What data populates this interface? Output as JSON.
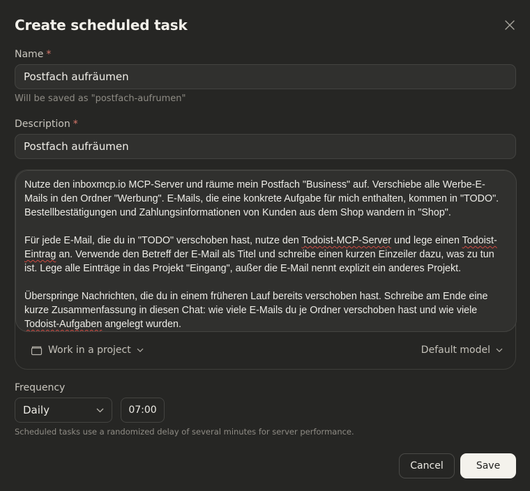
{
  "dialog": {
    "title": "Create scheduled task",
    "close_icon": "close-icon"
  },
  "name_field": {
    "label": "Name",
    "required_mark": "*",
    "value": "Postfach aufräumen",
    "hint": "Will be saved as \"postfach-aufrumen\""
  },
  "description_field": {
    "label": "Description",
    "required_mark": "*",
    "value": "Postfach aufräumen"
  },
  "prompt": {
    "p1": "Nutze den inboxmcp.io MCP-Server und räume mein Postfach \"Business\" auf. Verschiebe alle Werbe-E-Mails in den Ordner \"Werbung\". E-Mails, die eine konkrete Aufgabe für mich enthalten, kommen in \"TODO\". Bestellbestätigungen und Zahlungsinformationen von Kunden aus dem Shop wandern in \"Shop\".",
    "p2_a": "Für jede E-Mail, die du in \"TODO\" verschoben hast, nutze den ",
    "p2_b": "Todoist-MCP-Server",
    "p2_c": " und lege einen ",
    "p2_d": "Todoist-Eintrag",
    "p2_e": " an. Verwende den Betreff der E-Mail als Titel und schreibe einen kurzen Einzeiler dazu, was zu tun ist. Lege alle Einträge in das Projekt \"Eingang\", außer die E-Mail nennt explizit ein anderes Projekt.",
    "p3_a": "Überspringe Nachrichten, die du in einem früheren Lauf bereits verschoben hast. Schreibe am Ende eine kurze Zusammenfassung in diesen Chat: wie viele E-Mails du je Ordner verschoben hast und wie viele ",
    "p3_b": "Todoist-Aufgaben",
    "p3_c": " angelegt wurden."
  },
  "project_selector": {
    "label": "Work in a project",
    "icon": "folder-icon"
  },
  "model_selector": {
    "label": "Default model"
  },
  "frequency": {
    "label": "Frequency",
    "selected": "Daily",
    "time": "07:00",
    "hint": "Scheduled tasks use a randomized delay of several minutes for server performance."
  },
  "actions": {
    "cancel_label": "Cancel",
    "save_label": "Save"
  }
}
